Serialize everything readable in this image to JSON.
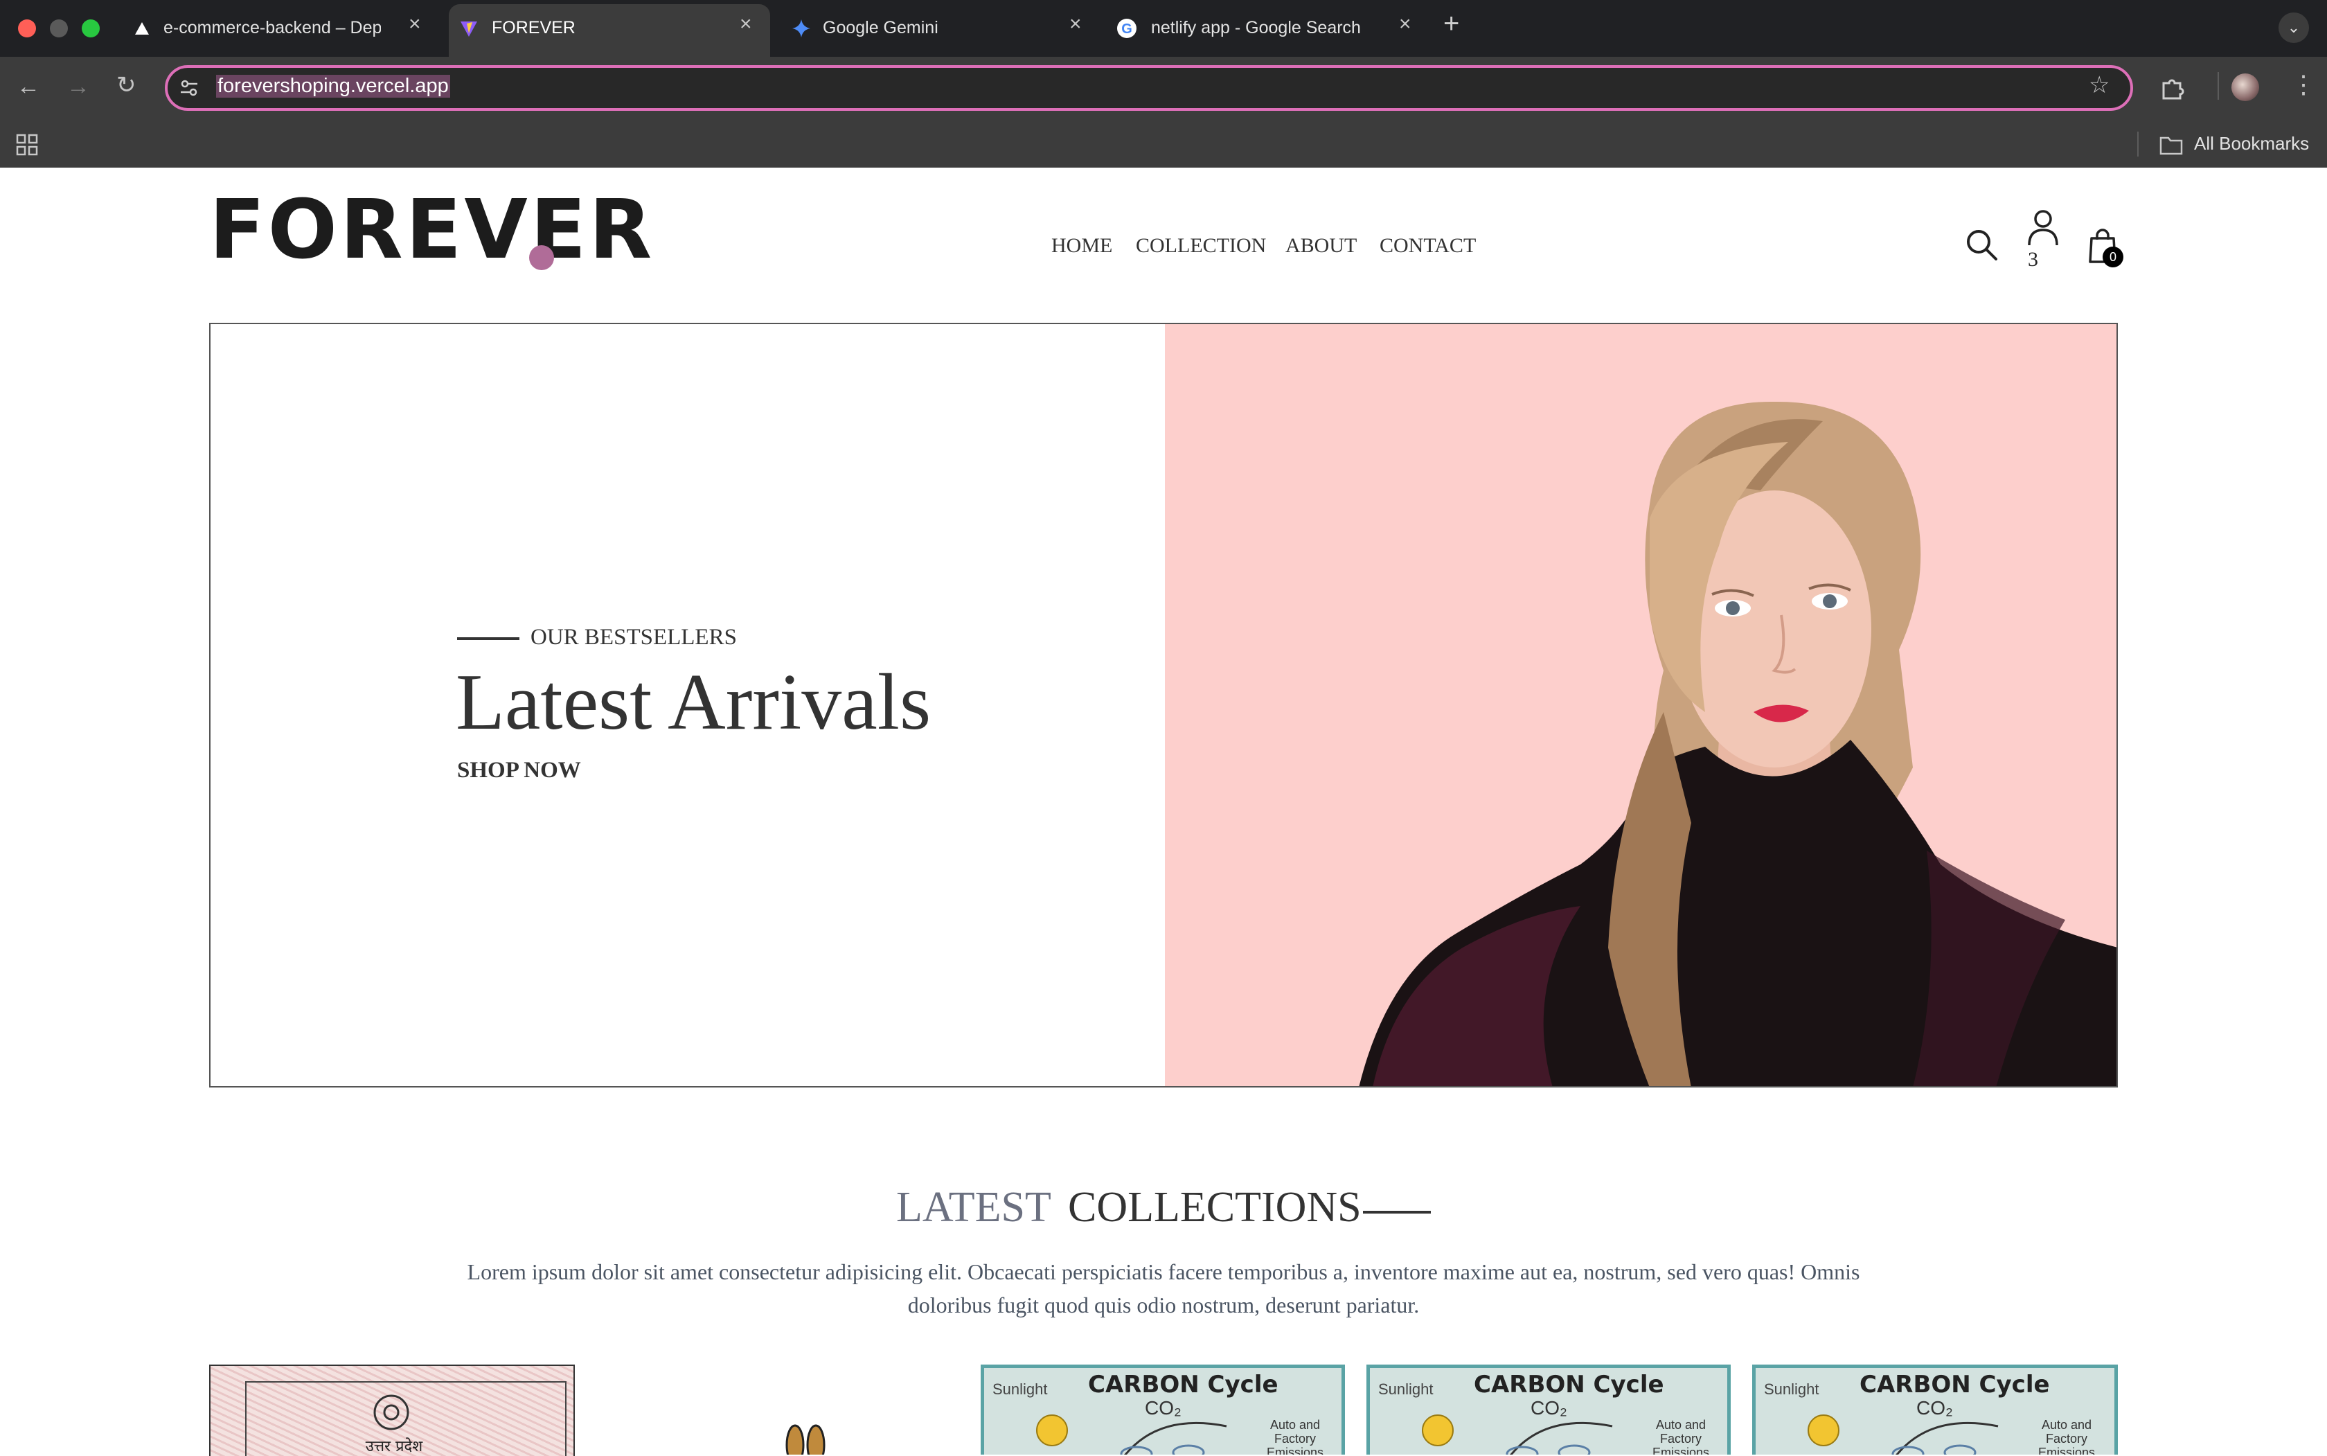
{
  "browser": {
    "tabs": [
      {
        "title": "e-commerce-backend – Depl",
        "favicon": "vercel-triangle-icon"
      },
      {
        "title": "FOREVER",
        "favicon": "vite-logo-icon",
        "active": true
      },
      {
        "title": "Google Gemini",
        "favicon": "gemini-star-icon"
      },
      {
        "title": "netlify app - Google Search",
        "favicon": "google-g-icon"
      }
    ],
    "url": "forevershoping.vercel.app",
    "bookmarks_label": "All Bookmarks"
  },
  "site": {
    "logo": "FOREVER",
    "nav": [
      "HOME",
      "COLLECTION",
      "ABOUT",
      "CONTACT"
    ],
    "user_badge": "3",
    "cart_count": "0"
  },
  "hero": {
    "eyebrow": "OUR BESTSELLERS",
    "title": "Latest Arrivals",
    "cta": "SHOP NOW",
    "bg_color": "#fdcfcc"
  },
  "latest": {
    "title_light": "LATEST",
    "title_bold": "COLLECTIONS",
    "description": "Lorem ipsum dolor sit amet consectetur adipisicing elit. Obcaecati perspiciatis facere temporibus a, inventore maxime aut ea, nostrum, sed vero quas! Omnis doloribus fugit quod quis odio nostrum, deserunt pariatur.",
    "products": [
      {
        "type": "document",
        "caption": "उत्तर प्रदेश शासन"
      },
      {
        "type": "rabbit"
      },
      {
        "type": "poster",
        "title": "CARBON Cycle",
        "sub": "CO₂",
        "label_a": "Sunlight",
        "label_b": "Auto and Factory Emissions"
      },
      {
        "type": "poster",
        "title": "CARBON Cycle",
        "sub": "CO₂",
        "label_a": "Sunlight",
        "label_b": "Auto and Factory Emissions"
      },
      {
        "type": "poster",
        "title": "CARBON Cycle",
        "sub": "CO₂",
        "label_a": "Sunlight",
        "label_b": "Auto and Factory Emissions"
      }
    ]
  }
}
